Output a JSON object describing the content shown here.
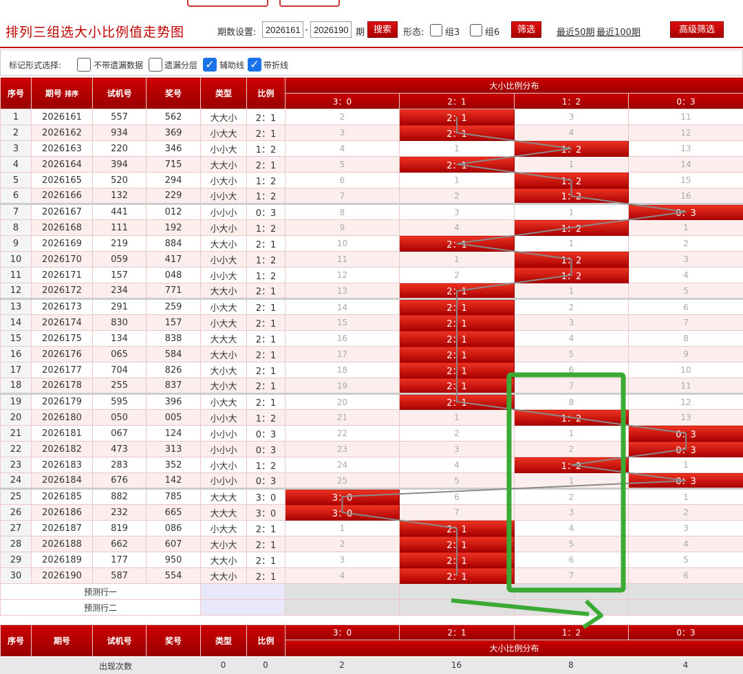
{
  "header": {
    "title": "排列三组选大小比例值走势图",
    "period_label": "期数设置:",
    "period_from": "2026161",
    "period_dash": "-",
    "period_to": "2026190",
    "period_suffix": "期",
    "search_label": "搜索",
    "form_label": "形态:",
    "group3_label": "组3",
    "group6_label": "组6",
    "filter_label": "筛选",
    "recent50_label": "最近50期",
    "recent100_label": "最近100期",
    "advanced_label": "高级筛选"
  },
  "markbar": {
    "label": "标记形式选择:",
    "options": [
      {
        "label": "不带遗漏数据",
        "checked": false
      },
      {
        "label": "遗漏分层",
        "checked": false
      },
      {
        "label": "辅助线",
        "checked": true
      },
      {
        "label": "带折线",
        "checked": true
      }
    ]
  },
  "table": {
    "headers": {
      "seq": "序号",
      "issue": "期号",
      "sort": "排序",
      "trial": "试机号",
      "prize": "奖号",
      "type": "类型",
      "ratio": "比例",
      "dist": "大小比例分布"
    },
    "dist_cols": [
      "3：0",
      "2：1",
      "1：2",
      "0：3"
    ],
    "rows": [
      {
        "seq": "1",
        "issue": "2026161",
        "trial": "557",
        "prize": "562",
        "type": "大大小",
        "ratio": "2：1",
        "hit": 1,
        "cells": [
          "2",
          "2：1",
          "3",
          "11"
        ]
      },
      {
        "seq": "2",
        "issue": "2026162",
        "trial": "934",
        "prize": "369",
        "type": "小大大",
        "ratio": "2：1",
        "hit": 1,
        "cells": [
          "3",
          "2：1",
          "4",
          "12"
        ]
      },
      {
        "seq": "3",
        "issue": "2026163",
        "trial": "220",
        "prize": "346",
        "type": "小小大",
        "ratio": "1：2",
        "hit": 2,
        "cells": [
          "4",
          "1",
          "1：2",
          "13"
        ]
      },
      {
        "seq": "4",
        "issue": "2026164",
        "trial": "394",
        "prize": "715",
        "type": "大大小",
        "ratio": "2：1",
        "hit": 1,
        "cells": [
          "5",
          "2：1",
          "1",
          "14"
        ]
      },
      {
        "seq": "5",
        "issue": "2026165",
        "trial": "520",
        "prize": "294",
        "type": "小大小",
        "ratio": "1：2",
        "hit": 2,
        "cells": [
          "6",
          "1",
          "1：2",
          "15"
        ]
      },
      {
        "seq": "6",
        "issue": "2026166",
        "trial": "132",
        "prize": "229",
        "type": "小小大",
        "ratio": "1：2",
        "hit": 2,
        "cells": [
          "7",
          "2",
          "1：2",
          "16"
        ]
      },
      {
        "seq": "7",
        "issue": "2026167",
        "trial": "441",
        "prize": "012",
        "type": "小小小",
        "ratio": "0：3",
        "hit": 3,
        "cells": [
          "8",
          "3",
          "1",
          "0：3"
        ]
      },
      {
        "seq": "8",
        "issue": "2026168",
        "trial": "111",
        "prize": "192",
        "type": "小大小",
        "ratio": "1：2",
        "hit": 2,
        "cells": [
          "9",
          "4",
          "1：2",
          "1"
        ]
      },
      {
        "seq": "9",
        "issue": "2026169",
        "trial": "219",
        "prize": "884",
        "type": "大大小",
        "ratio": "2：1",
        "hit": 1,
        "cells": [
          "10",
          "2：1",
          "1",
          "2"
        ]
      },
      {
        "seq": "10",
        "issue": "2026170",
        "trial": "059",
        "prize": "417",
        "type": "小小大",
        "ratio": "1：2",
        "hit": 2,
        "cells": [
          "11",
          "1",
          "1：2",
          "3"
        ]
      },
      {
        "seq": "11",
        "issue": "2026171",
        "trial": "157",
        "prize": "048",
        "type": "小小大",
        "ratio": "1：2",
        "hit": 2,
        "cells": [
          "12",
          "2",
          "1：2",
          "4"
        ]
      },
      {
        "seq": "12",
        "issue": "2026172",
        "trial": "234",
        "prize": "771",
        "type": "大大小",
        "ratio": "2：1",
        "hit": 1,
        "cells": [
          "13",
          "2：1",
          "1",
          "5"
        ]
      },
      {
        "seq": "13",
        "issue": "2026173",
        "trial": "291",
        "prize": "259",
        "type": "小大大",
        "ratio": "2：1",
        "hit": 1,
        "cells": [
          "14",
          "2：1",
          "2",
          "6"
        ]
      },
      {
        "seq": "14",
        "issue": "2026174",
        "trial": "830",
        "prize": "157",
        "type": "小大大",
        "ratio": "2：1",
        "hit": 1,
        "cells": [
          "15",
          "2：1",
          "3",
          "7"
        ]
      },
      {
        "seq": "15",
        "issue": "2026175",
        "trial": "134",
        "prize": "838",
        "type": "大大大",
        "ratio": "2：1",
        "hit": 1,
        "cells": [
          "16",
          "2：1",
          "4",
          "8"
        ]
      },
      {
        "seq": "16",
        "issue": "2026176",
        "trial": "065",
        "prize": "584",
        "type": "大大小",
        "ratio": "2：1",
        "hit": 1,
        "cells": [
          "17",
          "2：1",
          "5",
          "9"
        ]
      },
      {
        "seq": "17",
        "issue": "2026177",
        "trial": "704",
        "prize": "826",
        "type": "大小大",
        "ratio": "2：1",
        "hit": 1,
        "cells": [
          "18",
          "2：1",
          "6",
          "10"
        ]
      },
      {
        "seq": "18",
        "issue": "2026178",
        "trial": "255",
        "prize": "837",
        "type": "大小大",
        "ratio": "2：1",
        "hit": 1,
        "cells": [
          "19",
          "2：1",
          "7",
          "11"
        ]
      },
      {
        "seq": "19",
        "issue": "2026179",
        "trial": "595",
        "prize": "396",
        "type": "小大大",
        "ratio": "2：1",
        "hit": 1,
        "cells": [
          "20",
          "2：1",
          "8",
          "12"
        ]
      },
      {
        "seq": "20",
        "issue": "2026180",
        "trial": "050",
        "prize": "005",
        "type": "小小大",
        "ratio": "1：2",
        "hit": 2,
        "cells": [
          "21",
          "1",
          "1：2",
          "13"
        ]
      },
      {
        "seq": "21",
        "issue": "2026181",
        "trial": "067",
        "prize": "124",
        "type": "小小小",
        "ratio": "0：3",
        "hit": 3,
        "cells": [
          "22",
          "2",
          "1",
          "0：3"
        ]
      },
      {
        "seq": "22",
        "issue": "2026182",
        "trial": "473",
        "prize": "313",
        "type": "小小小",
        "ratio": "0：3",
        "hit": 3,
        "cells": [
          "23",
          "3",
          "2",
          "0：3"
        ]
      },
      {
        "seq": "23",
        "issue": "2026183",
        "trial": "283",
        "prize": "352",
        "type": "小大小",
        "ratio": "1：2",
        "hit": 2,
        "cells": [
          "24",
          "4",
          "1：2",
          "1"
        ]
      },
      {
        "seq": "24",
        "issue": "2026184",
        "trial": "676",
        "prize": "142",
        "type": "小小小",
        "ratio": "0：3",
        "hit": 3,
        "cells": [
          "25",
          "5",
          "1",
          "0：3"
        ]
      },
      {
        "seq": "25",
        "issue": "2026185",
        "trial": "882",
        "prize": "785",
        "type": "大大大",
        "ratio": "3：0",
        "hit": 0,
        "cells": [
          "3：0",
          "6",
          "2",
          "1"
        ]
      },
      {
        "seq": "26",
        "issue": "2026186",
        "trial": "232",
        "prize": "665",
        "type": "大大大",
        "ratio": "3：0",
        "hit": 0,
        "cells": [
          "3：0",
          "7",
          "3",
          "2"
        ]
      },
      {
        "seq": "27",
        "issue": "2026187",
        "trial": "819",
        "prize": "086",
        "type": "小大大",
        "ratio": "2：1",
        "hit": 1,
        "cells": [
          "1",
          "2：1",
          "4",
          "3"
        ]
      },
      {
        "seq": "28",
        "issue": "2026188",
        "trial": "662",
        "prize": "607",
        "type": "大小大",
        "ratio": "2：1",
        "hit": 1,
        "cells": [
          "2",
          "2：1",
          "5",
          "4"
        ]
      },
      {
        "seq": "29",
        "issue": "2026189",
        "trial": "177",
        "prize": "950",
        "type": "大大小",
        "ratio": "2：1",
        "hit": 1,
        "cells": [
          "3",
          "2：1",
          "6",
          "5"
        ]
      },
      {
        "seq": "30",
        "issue": "2026190",
        "trial": "587",
        "prize": "554",
        "type": "大大小",
        "ratio": "2：1",
        "hit": 1,
        "cells": [
          "4",
          "2：1",
          "7",
          "6"
        ]
      }
    ],
    "pred1_label": "预测行一",
    "pred2_label": "预测行二"
  },
  "footer": {
    "stat_label": "出现次数",
    "stat_type": "0",
    "stat_ratio": "0",
    "stat_cells": [
      "2",
      "16",
      "8",
      "4"
    ]
  },
  "colors": {
    "header_red": "#c00000",
    "hit_red": "#d11",
    "annotation_green": "#3aaa35"
  }
}
